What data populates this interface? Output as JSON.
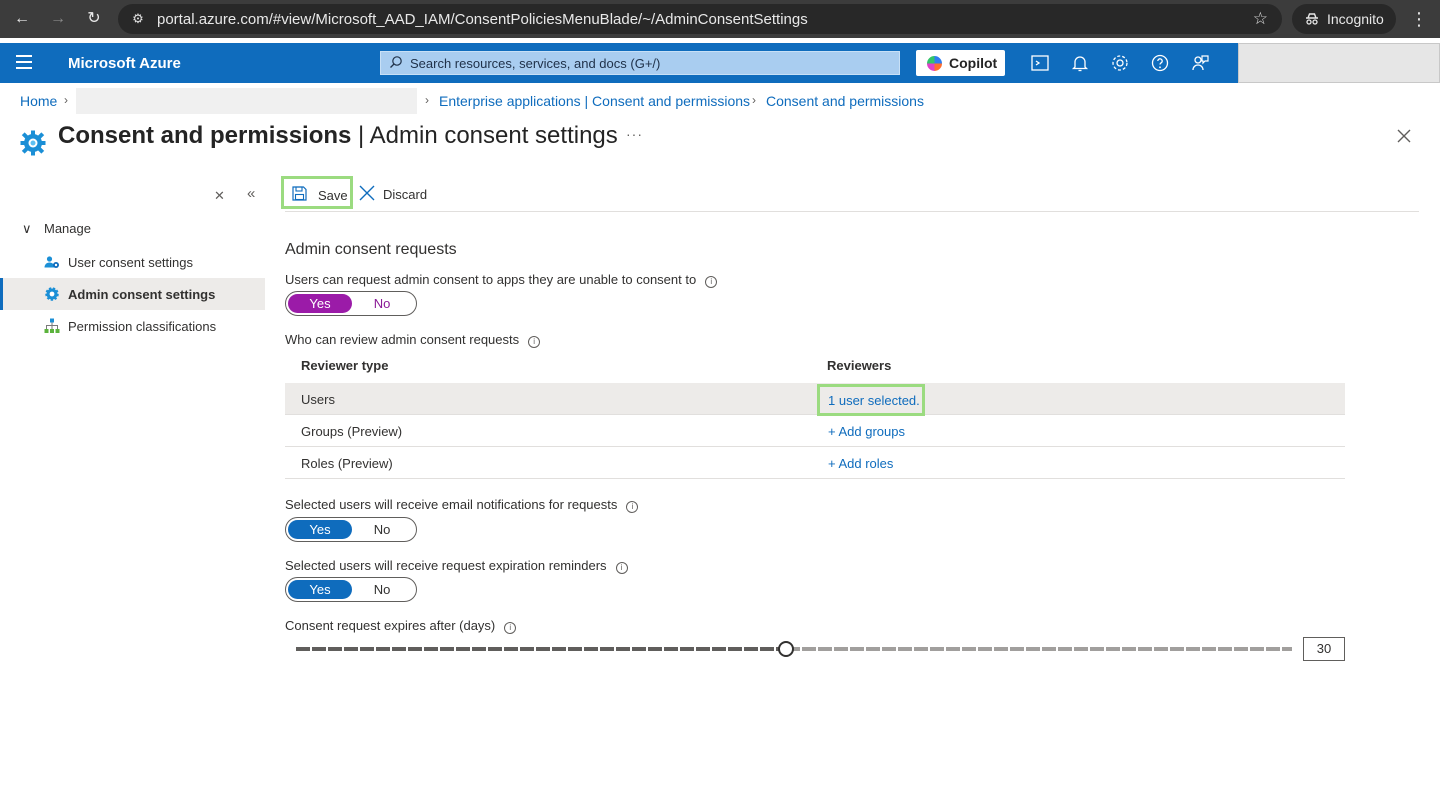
{
  "browser": {
    "url": "portal.azure.com/#view/Microsoft_AAD_IAM/ConsentPoliciesMenuBlade/~/AdminConsentSettings",
    "profile_label": "Incognito"
  },
  "topbar": {
    "brand": "Microsoft Azure",
    "search_placeholder": "Search resources, services, and docs (G+/)",
    "copilot_label": "Copilot"
  },
  "breadcrumb": {
    "home": "Home",
    "items": [
      "Enterprise applications | Consent and permissions",
      "Consent and permissions"
    ]
  },
  "page": {
    "title_bold": "Consent and permissions",
    "title_rest": " | Admin consent settings",
    "more": "···"
  },
  "sidebar": {
    "group": "Manage",
    "items": [
      {
        "label": "User consent settings"
      },
      {
        "label": "Admin consent settings"
      },
      {
        "label": "Permission classifications"
      }
    ]
  },
  "commands": {
    "save": "Save",
    "discard": "Discard"
  },
  "content": {
    "section_title": "Admin consent requests",
    "request_toggle": {
      "label": "Users can request admin consent to apps they are unable to consent to",
      "yes": "Yes",
      "no": "No",
      "selected": "Yes"
    },
    "reviewers_label": "Who can review admin consent requests",
    "table": {
      "headers": [
        "Reviewer type",
        "Reviewers"
      ],
      "rows": [
        {
          "type": "Users",
          "reviewers": "1 user selected."
        },
        {
          "type": "Groups (Preview)",
          "reviewers": "+ Add groups"
        },
        {
          "type": "Roles (Preview)",
          "reviewers": "+ Add roles"
        }
      ]
    },
    "email_toggle": {
      "label": "Selected users will receive email notifications for requests",
      "yes": "Yes",
      "no": "No",
      "selected": "Yes"
    },
    "reminder_toggle": {
      "label": "Selected users will receive request expiration reminders",
      "yes": "Yes",
      "no": "No",
      "selected": "Yes"
    },
    "expiry": {
      "label": "Consent request expires after (days)",
      "value": "30",
      "min": 1,
      "max": 60
    }
  },
  "colors": {
    "azure_blue": "#0f6cbd",
    "toggle_purple": "#9b1ba8",
    "highlight_green": "#9bdb80"
  }
}
